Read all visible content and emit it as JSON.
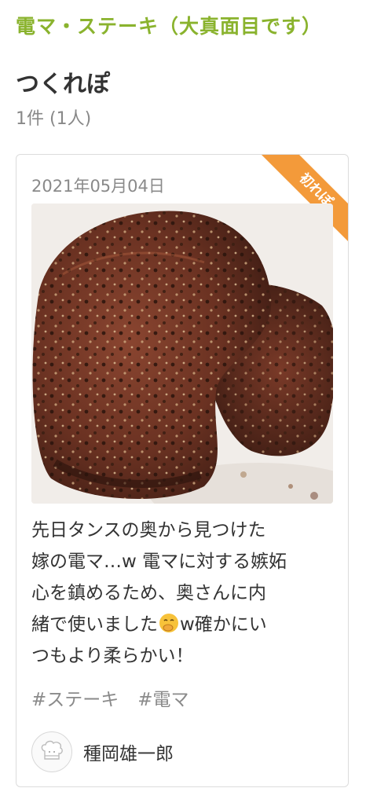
{
  "recipe": {
    "title": "電マ・ステーキ（大真面目です）"
  },
  "tsukurepo": {
    "heading": "つくれぽ",
    "count_text": "1件 (1人)"
  },
  "card": {
    "badge": "初れぽ",
    "date": "2021年05月04日",
    "photo": "steak-photo",
    "comment_line1": "先日タンスの奥から見つけた",
    "comment_line2": "嫁の電マ…w 電マに対する嫉妬",
    "comment_line3": "心を鎮めるため、奥さんに内",
    "comment_line4a": "緒で使いました",
    "comment_line4b": "w確かにい",
    "comment_line5": "つもより柔らかい！",
    "emoji": "face-with-hand-over-mouth-emoji",
    "tags": [
      "#ステーキ",
      "#電マ"
    ],
    "author": {
      "name": "種岡雄一郎",
      "avatar_icon": "chef-hat-avatar-icon"
    }
  },
  "colors": {
    "title_green": "#8ab32e",
    "badge_orange": "#f39a3a",
    "muted_gray": "#8a8a8a"
  }
}
